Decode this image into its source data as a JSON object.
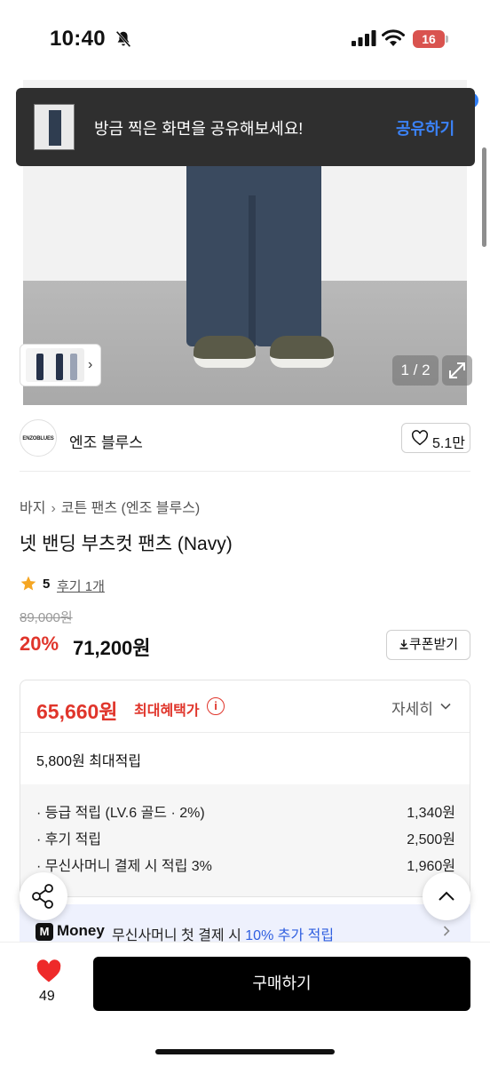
{
  "status_bar": {
    "time": "10:40",
    "battery": "16"
  },
  "toast": {
    "message": "방금 찍은 화면을 공유해보세요!",
    "action": "공유하기"
  },
  "gallery": {
    "page_indicator": "1 / 2"
  },
  "brand": {
    "logo_text": "ENZOBLUES",
    "name": "엔조 블루스",
    "likes": "5.1만"
  },
  "product": {
    "breadcrumb": [
      "바지",
      "코튼 팬츠 (엔조 블루스)"
    ],
    "title": "넷 밴딩 부츠컷 팬츠 (Navy)",
    "rating": "5",
    "reviews": "후기 1개",
    "original_price": "89,000원",
    "discount": "20%",
    "sale_price": "71,200원",
    "coupon_label": "쿠폰받기"
  },
  "benefit": {
    "price": "65,660원",
    "label": "최대혜택가",
    "detail_label": "자세히",
    "max_points": "5,800원 최대적립",
    "rows": [
      {
        "label": "· 등급 적립 (LV.6 골드 · 2%)",
        "value": "1,340원"
      },
      {
        "label": "· 후기 적립",
        "value": "2,500원"
      },
      {
        "label": "· 무신사머니 결제 시 적립 3%",
        "value": "1,960원"
      }
    ]
  },
  "money_banner": {
    "logo": "M",
    "brand": "Money",
    "text": "무신사머니 첫 결제 시 ",
    "highlight": "10% 추가 적립"
  },
  "bottom": {
    "favorite_count": "49",
    "buy_label": "구매하기"
  },
  "colors": {
    "accent_red": "#e0352b",
    "link_blue": "#3b82f6",
    "buy_button": "#000000"
  }
}
